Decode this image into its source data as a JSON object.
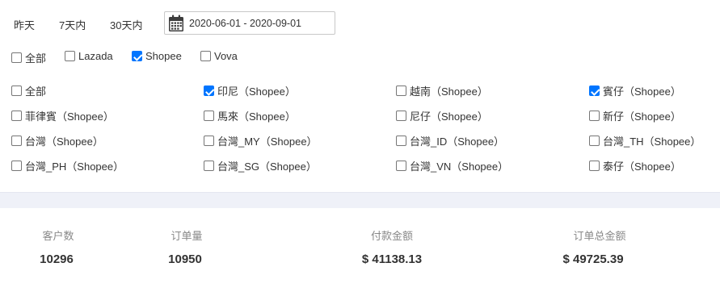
{
  "date_filter": {
    "quick_ranges": [
      "昨天",
      "7天内",
      "30天内"
    ],
    "range_value": "2020-06-01 - 2020-09-01",
    "calendar_icon": "calendar-icon"
  },
  "platforms": [
    {
      "label": "全部",
      "checked": false
    },
    {
      "label": "Lazada",
      "checked": false
    },
    {
      "label": "Shopee",
      "checked": true
    },
    {
      "label": "Vova",
      "checked": false
    }
  ],
  "stores": [
    {
      "label": "全部",
      "checked": false
    },
    {
      "label": "印尼（Shopee）",
      "checked": true
    },
    {
      "label": "越南（Shopee）",
      "checked": false
    },
    {
      "label": "賓仔（Shopee）",
      "checked": true
    },
    {
      "label": "菲律賓（Shopee）",
      "checked": false
    },
    {
      "label": "馬來（Shopee）",
      "checked": false
    },
    {
      "label": "尼仔（Shopee）",
      "checked": false
    },
    {
      "label": "新仔（Shopee）",
      "checked": false
    },
    {
      "label": "台灣（Shopee）",
      "checked": false
    },
    {
      "label": "台灣_MY（Shopee）",
      "checked": false
    },
    {
      "label": "台灣_ID（Shopee）",
      "checked": false
    },
    {
      "label": "台灣_TH（Shopee）",
      "checked": false
    },
    {
      "label": "台灣_PH（Shopee）",
      "checked": false
    },
    {
      "label": "台灣_SG（Shopee）",
      "checked": false
    },
    {
      "label": "台灣_VN（Shopee）",
      "checked": false
    },
    {
      "label": "泰仔（Shopee）",
      "checked": false
    }
  ],
  "stats": [
    {
      "label": "客户数",
      "value": "10296"
    },
    {
      "label": "订单量",
      "value": "10950"
    },
    {
      "label": "付款金额",
      "value": "$ 41138.13"
    },
    {
      "label": "订单总金额",
      "value": "$ 49725.39"
    }
  ]
}
